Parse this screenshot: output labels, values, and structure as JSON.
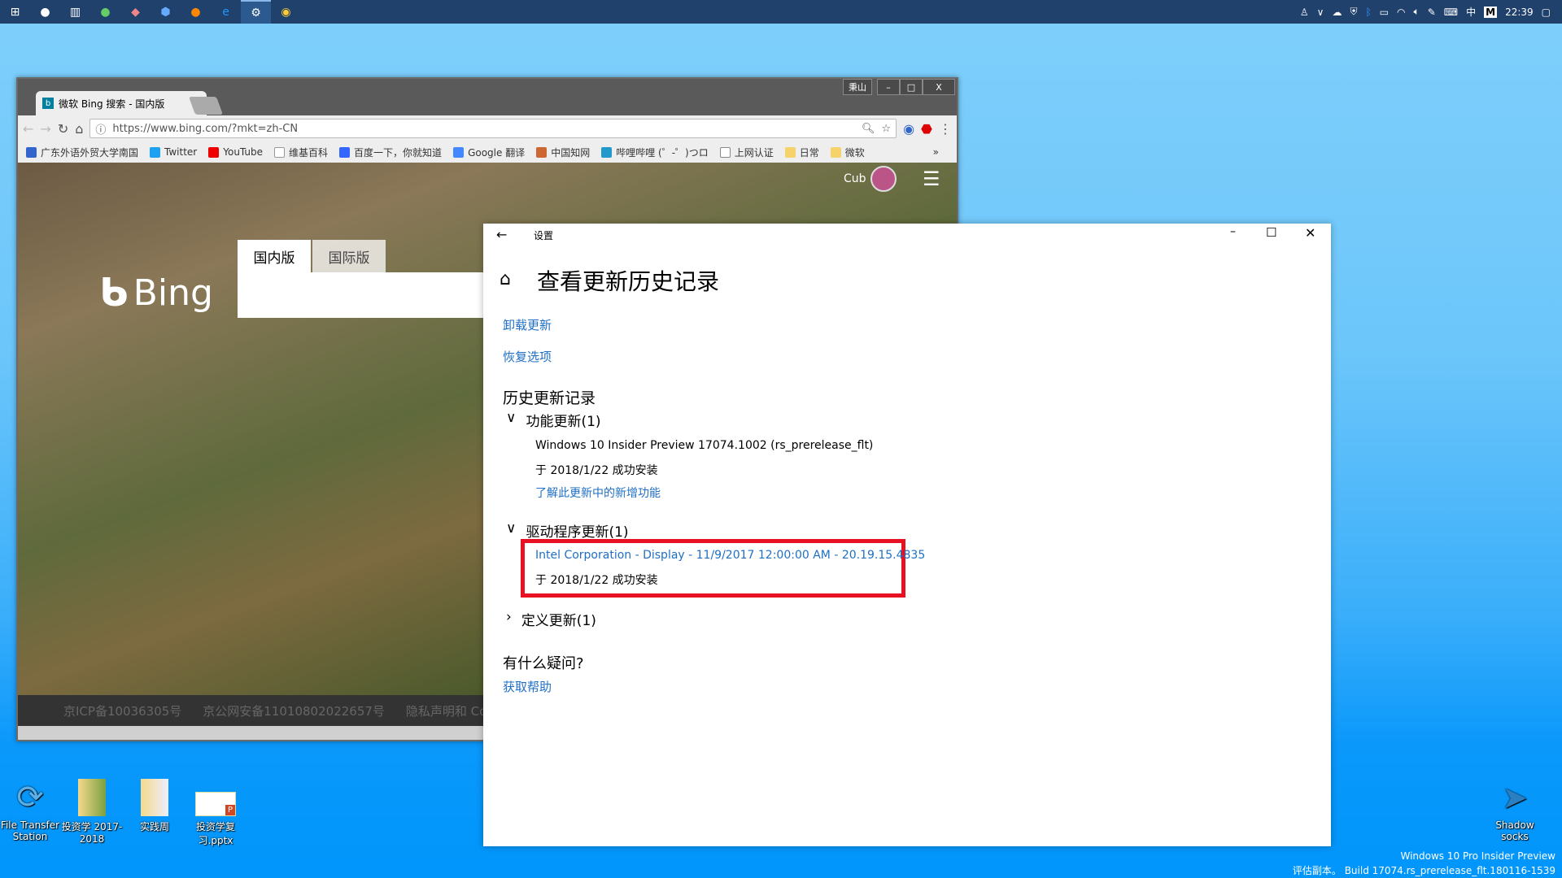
{
  "taskbar": {
    "apps": [
      "start-icon",
      "cortana-icon",
      "task-view-icon",
      "wechat-icon",
      "app-icon",
      "shield-app-icon",
      "firefox-icon",
      "edge-icon",
      "settings-icon",
      "chrome-icon"
    ],
    "clock": "22:39",
    "ime": "中",
    "ime2": "M"
  },
  "chrome": {
    "tab_title": "微软 Bing 搜索 - 国内版",
    "profile_label": "秉山",
    "url": "https://www.bing.com/?mkt=zh-CN",
    "bookmarks": [
      "广东外语外贸大学南国",
      "Twitter",
      "YouTube",
      "维基百科",
      "百度一下，你就知道",
      "Google 翻译",
      "中国知网",
      "哔哩哔哩 (゜-゜)つロ",
      "上网认证",
      "日常",
      "微软"
    ],
    "bookmarks_more": "»"
  },
  "bing": {
    "logo": "Bing",
    "tabs": [
      "国内版",
      "国际版"
    ],
    "user": "Cub",
    "footer": [
      "京ICP备10036305号",
      "京公网安备11010802022657号",
      "隐私声明和 Cookie"
    ]
  },
  "settings": {
    "window_title": "设置",
    "page_title": "查看更新历史记录",
    "uninstall_link": "卸载更新",
    "recovery_link": "恢复选项",
    "history_heading": "历史更新记录",
    "groups": [
      {
        "title": "功能更新(1)",
        "expanded": true,
        "items": [
          {
            "name": "Windows 10 Insider Preview 17074.1002 (rs_prerelease_flt)",
            "status": "于 2018/1/22 成功安装",
            "link": "了解此更新中的新增功能"
          }
        ]
      },
      {
        "title": "驱动程序更新(1)",
        "expanded": true,
        "items": [
          {
            "name": "Intel Corporation - Display - 11/9/2017 12:00:00 AM - 20.19.15.4835",
            "status": "于 2018/1/22 成功安装"
          }
        ]
      },
      {
        "title": "定义更新(1)",
        "expanded": false
      }
    ],
    "question_heading": "有什么疑问?",
    "help_link": "获取帮助",
    "highlight_color": "#e81123",
    "link_color": "#1f6fc5"
  },
  "desktop": {
    "icons": [
      {
        "label": "File Transfer Station"
      },
      {
        "label": "投资学 2017-2018"
      },
      {
        "label": "实践周"
      },
      {
        "label": "投资学复习.pptx"
      },
      {
        "label": "Shadow socks"
      }
    ],
    "watermark": [
      "Windows 10 Pro Insider Preview",
      "评估副本。 Build 17074.rs_prerelease_flt.180116-1539"
    ]
  }
}
